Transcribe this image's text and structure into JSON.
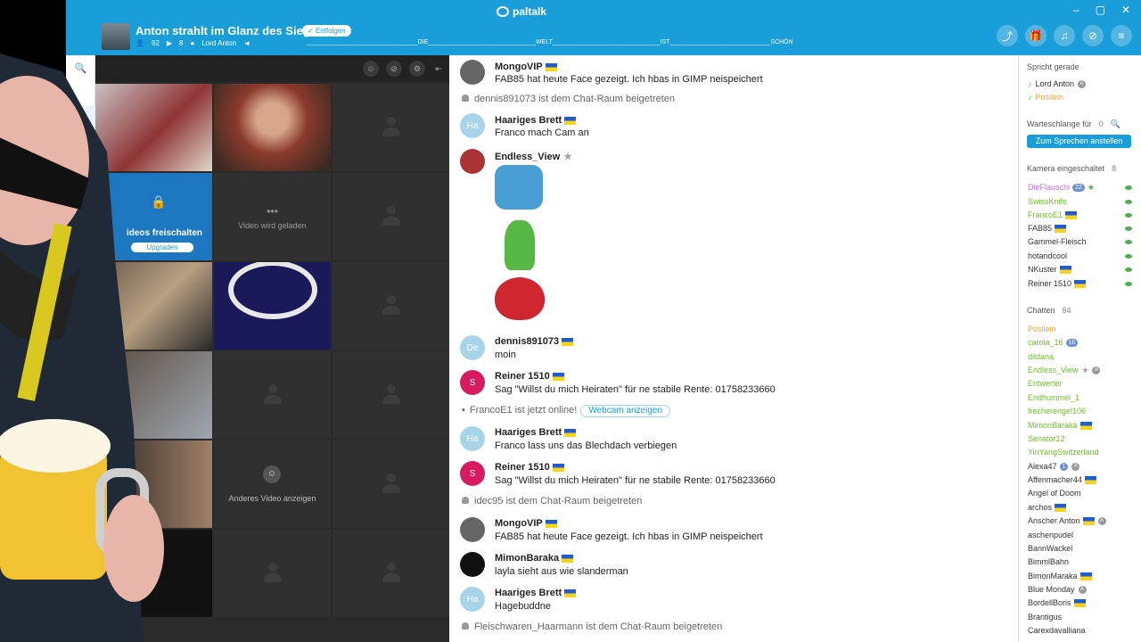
{
  "app": {
    "name": "paltalk"
  },
  "header": {
    "room_title": "Anton strahlt im Glanz des Siegers",
    "follow_label": "Entfolgen",
    "users_count": "92",
    "cams_count": "8",
    "host": "Lord Anton",
    "ticker": "________________________________DIE_______________________________WELT_______________________________IST_____________________________SCHÖN"
  },
  "video": {
    "locked_label": "ideos freischalten",
    "upgrade_label": "Upgraden",
    "loading_label": "Video wird geladen",
    "other_video_label": "Anderes Video anzeigen"
  },
  "chat": {
    "messages": [
      {
        "user": "MongoVIP",
        "text": "FAB85 hat heute Face gezeigt. Ich hbas in GIMP neispeichert"
      },
      {
        "sys": "dennis891073 ist dem Chat-Raum beigetreten"
      },
      {
        "user": "Haariges Brett",
        "avatar": "Ha",
        "text": "Franco mach Cam an"
      },
      {
        "user": "Endless_View"
      },
      {
        "user": "dennis891073",
        "avatar": "De",
        "text": "moin"
      },
      {
        "user": "Reiner 1510",
        "avatar": "S",
        "text": "Sag \"Willst du mich Heiraten\" für ne stabile Rente: 01758233660"
      },
      {
        "sys": "FrancoE1 ist jetzt online!",
        "button": "Webcam anzeigen"
      },
      {
        "user": "Haariges Brett",
        "avatar": "Ha",
        "text": "Franco lass uns das Blechdach verbiegen"
      },
      {
        "user": "Reiner 1510",
        "avatar": "S",
        "text": "Sag \"Willst du mich Heiraten\" für ne stabile Rente: 01758233660"
      },
      {
        "sys": "idec95 ist dem Chat-Raum beigetreten"
      },
      {
        "user": "MongoVIP",
        "text": "FAB85 hat heute Face gezeigt. Ich hbas in GIMP neispeichert"
      },
      {
        "user": "MimonBaraka",
        "text": "layla sieht aus wie slanderman"
      },
      {
        "user": "Haariges Brett",
        "avatar": "Ha",
        "text": "Hagebuddne"
      },
      {
        "sys": "Fleischwaren_Haarmann ist dem Chat-Raum beigetreten"
      }
    ]
  },
  "people": {
    "speaking_title": "Spricht gerade",
    "speaking": [
      "Lord Anton",
      "Posilein"
    ],
    "queue_title": "Warteschlange für",
    "queue_count": "0",
    "speak_button": "Zum Sprechen anstellen",
    "cams_title": "Kamera eingeschaltet",
    "cams_count": "8",
    "cams": [
      "DieFlauschi",
      "SwissKnife",
      "FrancoE1",
      "FAB85",
      "Gammel-Fleisch",
      "hotandcool",
      "NKuster",
      "Reiner 1510"
    ],
    "cam_badge": "22",
    "chat_title": "Chatten",
    "chat_count": "84",
    "chatters": [
      "Posilein",
      "carola_16",
      "dildana",
      "Endless_View",
      "Entwerter",
      "Endhummel_1",
      "frecherengel106",
      "MimonBaraka",
      "Senator12",
      "YinYangSwitzerland",
      "Alexa47",
      "Affenmacher44",
      "Angel of Doom",
      "archos",
      "Anscher Anton",
      "aschenpudel",
      "BannWackel",
      "BimmlBahn",
      "BimonMaraka",
      "Blue Monday",
      "BordellBoris",
      "Brantigus",
      "Carexdavalliana"
    ],
    "chatter_badges": {
      "carola_16": "16",
      "Alexa47": "1"
    }
  },
  "colors": {
    "brand": "#1a9ed9",
    "online_green": "#6cbf2a",
    "staff_orange": "#e9a33b"
  }
}
